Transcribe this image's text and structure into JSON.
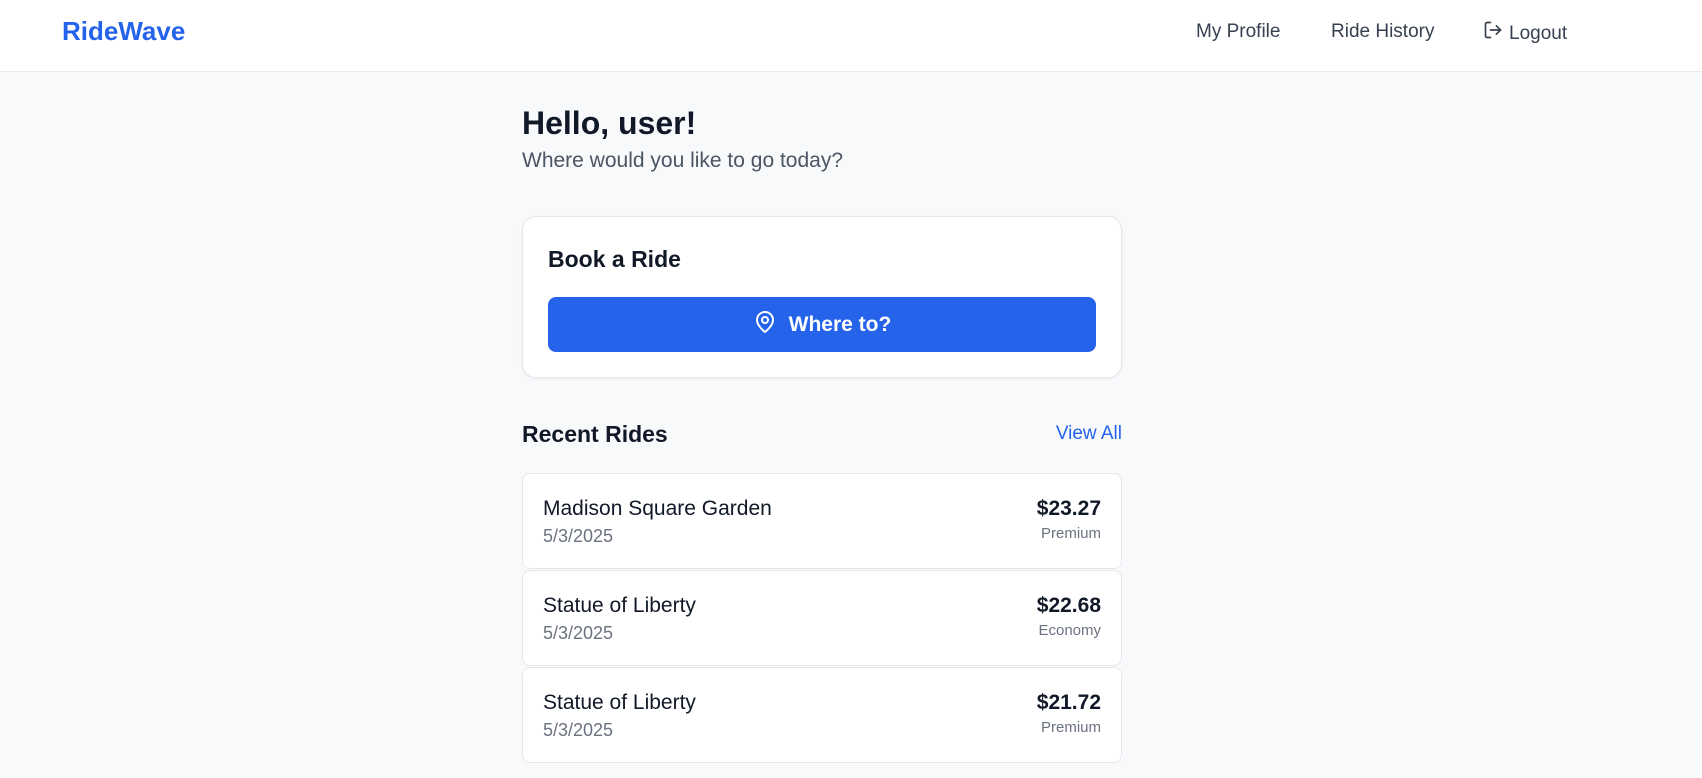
{
  "header": {
    "logo": "RideWave",
    "nav": {
      "profile": "My Profile",
      "history": "Ride History",
      "logout": "Logout"
    }
  },
  "main": {
    "greeting": "Hello, user!",
    "subtitle": "Where would you like to go today?",
    "book": {
      "title": "Book a Ride",
      "button_label": "Where to?"
    },
    "recent": {
      "title": "Recent Rides",
      "view_all": "View All",
      "rides": [
        {
          "destination": "Madison Square Garden",
          "date": "5/3/2025",
          "price": "$23.27",
          "type": "Premium"
        },
        {
          "destination": "Statue of Liberty",
          "date": "5/3/2025",
          "price": "$22.68",
          "type": "Economy"
        },
        {
          "destination": "Statue of Liberty",
          "date": "5/3/2025",
          "price": "$21.72",
          "type": "Premium"
        }
      ]
    }
  },
  "colors": {
    "brand": "#2563eb",
    "background": "#f8f9fb"
  },
  "icons": {
    "logout": "logout-icon",
    "location": "map-pin-icon"
  }
}
